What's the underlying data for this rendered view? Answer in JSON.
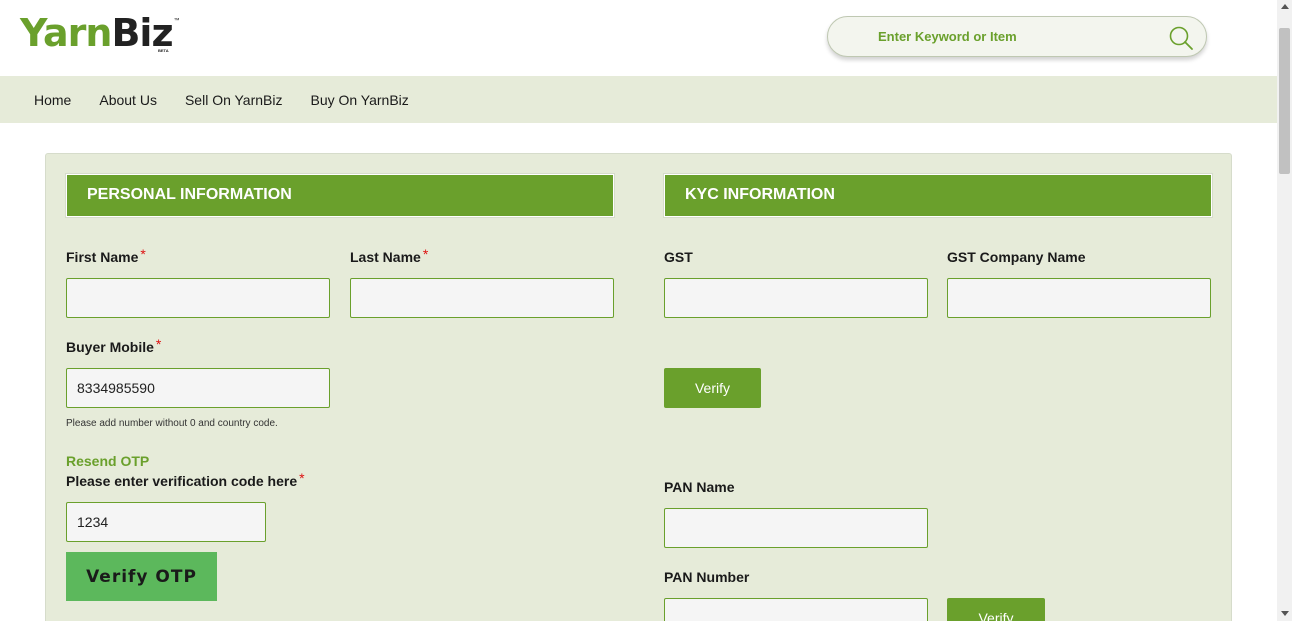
{
  "header": {
    "logo_part1": "Yarn",
    "logo_part2": "Biz",
    "logo_tm": "™",
    "logo_beta": "BETA",
    "search_placeholder": "Enter Keyword or Item"
  },
  "nav": {
    "items": [
      {
        "label": "Home"
      },
      {
        "label": "About Us"
      },
      {
        "label": "Sell On YarnBiz"
      },
      {
        "label": "Buy On YarnBiz"
      }
    ]
  },
  "personal": {
    "title": "PERSONAL INFORMATION",
    "first_name_label": "First Name",
    "first_name_value": "",
    "last_name_label": "Last Name",
    "last_name_value": "",
    "mobile_label": "Buyer Mobile",
    "mobile_value": "8334985590",
    "mobile_hint": "Please add number without 0 and country code.",
    "resend_otp": "Resend OTP",
    "otp_label": "Please enter verification code here",
    "otp_value": "1234",
    "verify_otp": "Verify OTP",
    "required_mark": "*"
  },
  "kyc": {
    "title": "KYC INFORMATION",
    "gst_label": "GST",
    "gst_value": "",
    "gst_company_label": "GST Company Name",
    "gst_company_value": "",
    "verify_gst": "Verify",
    "pan_name_label": "PAN Name",
    "pan_name_value": "",
    "pan_number_label": "PAN Number",
    "pan_number_value": "",
    "verify_pan": "Verify"
  },
  "colors": {
    "brand_green": "#6aa02c",
    "otp_button": "#5cb85c",
    "panel_bg": "#e6ebd9",
    "required": "#dd1111"
  }
}
